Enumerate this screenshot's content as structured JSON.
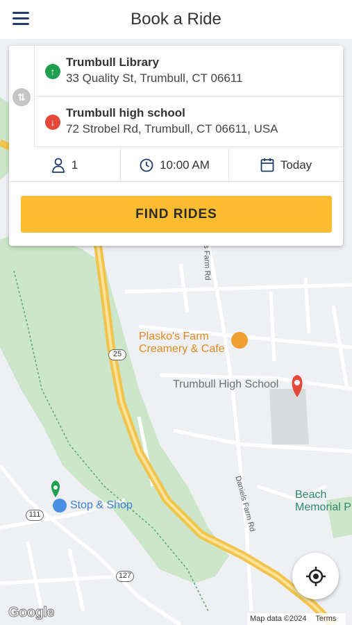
{
  "header": {
    "title": "Book a Ride",
    "menu_icon": "hamburger-menu-icon"
  },
  "trip": {
    "pickup": {
      "name": "Trumbull Library",
      "address": "33 Quality St, Trumbull, CT 06611",
      "icon": "arrow-up-icon",
      "color": "#1fa04e"
    },
    "dropoff": {
      "name": "Trumbull high school",
      "address": "72 Strobel Rd, Trumbull, CT 06611, USA",
      "icon": "arrow-down-icon",
      "color": "#e3483b"
    },
    "swap_icon": "swap-vertical-icon",
    "passengers": "1",
    "time": "10:00 AM",
    "date": "Today",
    "find_label": "FIND RIDES",
    "accent": "#fbbc32"
  },
  "map": {
    "places": {
      "farm": "Plasko's Farm\nCreamery & Cafe",
      "school": "Trumbull High School",
      "store": "Stop & Shop",
      "beach": "Beach\nMemorial P"
    },
    "roads": {
      "farm_rd_north": "s Farm Rd",
      "farm_rd_south": "Daniels Farm Rd"
    },
    "route_shields": [
      "25",
      "111",
      "127"
    ],
    "logo": "Google",
    "map_data": "Map data ©2024",
    "terms": "Terms"
  }
}
